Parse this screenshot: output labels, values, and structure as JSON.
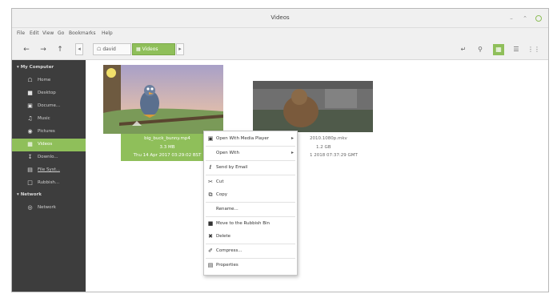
{
  "window": {
    "title": "Videos"
  },
  "menubar": {
    "items": [
      "File",
      "Edit",
      "View",
      "Go",
      "Bookmarks",
      "Help"
    ]
  },
  "toolbar": {
    "back_icon": "arrow-left-icon",
    "forward_icon": "arrow-right-icon",
    "up_icon": "arrow-up-icon",
    "breadcrumb_home": "david",
    "breadcrumb_current": "Videos"
  },
  "sidebar": {
    "section_computer": "My Computer",
    "items": [
      {
        "label": "Home",
        "icon": "home-icon"
      },
      {
        "label": "Desktop",
        "icon": "desktop-icon"
      },
      {
        "label": "Docume...",
        "icon": "documents-icon"
      },
      {
        "label": "Music",
        "icon": "music-icon"
      },
      {
        "label": "Pictures",
        "icon": "pictures-icon"
      },
      {
        "label": "Videos",
        "icon": "videos-icon"
      },
      {
        "label": "Downlo...",
        "icon": "download-icon"
      },
      {
        "label": "File Syst...",
        "icon": "drive-icon"
      },
      {
        "label": "Rubbish...",
        "icon": "trash-icon"
      }
    ],
    "section_network": "Network",
    "network_items": [
      {
        "label": "Network",
        "icon": "network-icon"
      }
    ]
  },
  "files": [
    {
      "name": "big_buck_bunny.mp4",
      "size": "3.3 MB",
      "date": "Thu 14 Apr 2017 03:29:02 BST"
    },
    {
      "name": "2010.1080p.mkv",
      "size": "1.2 GB",
      "date": "1 2018 07:37:29 GMT"
    }
  ],
  "context_menu": {
    "items": [
      {
        "label": "Open With Media Player",
        "icon": "media-player-icon",
        "submenu": true
      },
      {
        "label": "Open With",
        "icon": "",
        "submenu": true
      },
      {
        "label": "Send by Email",
        "icon": "attachment-icon",
        "submenu": false
      },
      {
        "label": "Cut",
        "icon": "scissors-icon",
        "submenu": false
      },
      {
        "label": "Copy",
        "icon": "copy-icon",
        "submenu": false
      },
      {
        "label": "Rename...",
        "icon": "",
        "submenu": false
      },
      {
        "label": "Move to the Rubbish Bin",
        "icon": "trash-icon",
        "submenu": false
      },
      {
        "label": "Delete",
        "icon": "delete-icon",
        "submenu": false
      },
      {
        "label": "Compress...",
        "icon": "compress-icon",
        "submenu": false
      },
      {
        "label": "Properties",
        "icon": "properties-icon",
        "submenu": false
      }
    ]
  },
  "colors": {
    "accent": "#8fbf5a",
    "sidebar_bg": "#3d3d3d"
  }
}
